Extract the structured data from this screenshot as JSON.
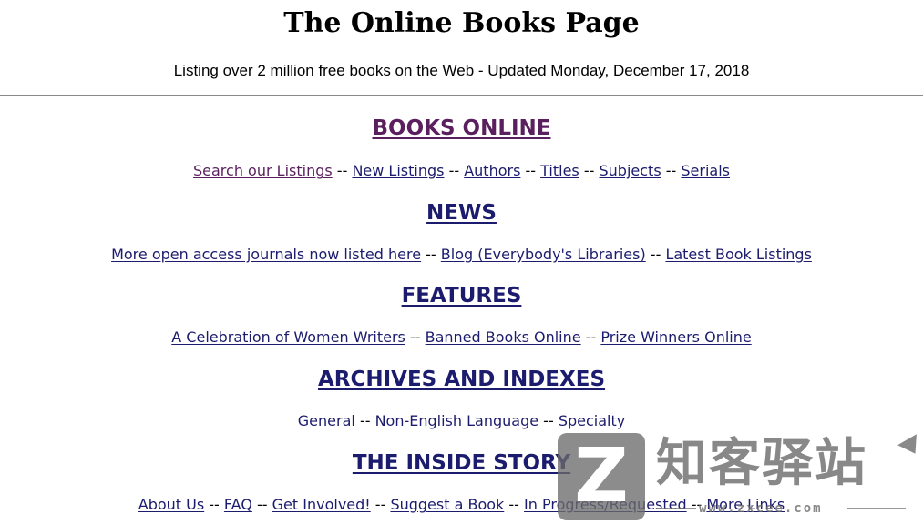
{
  "header": {
    "title": "The Online Books Page",
    "tagline": "Listing over 2 million free books on the Web - Updated Monday, December 17, 2018"
  },
  "separator": "--",
  "sections": [
    {
      "heading": "BOOKS ONLINE",
      "links": [
        "Search our Listings",
        "New Listings",
        "Authors",
        "Titles",
        "Subjects",
        "Serials"
      ]
    },
    {
      "heading": "NEWS",
      "links": [
        "More open access journals now listed here",
        "Blog (Everybody's Libraries)",
        "Latest Book Listings"
      ]
    },
    {
      "heading": "FEATURES",
      "links": [
        "A Celebration of Women Writers",
        "Banned Books Online",
        "Prize Winners Online"
      ]
    },
    {
      "heading": "ARCHIVES AND INDEXES",
      "links": [
        "General",
        "Non-English Language",
        "Specialty"
      ]
    },
    {
      "heading": "THE INSIDE STORY",
      "links": [
        "About Us",
        "FAQ",
        "Get Involved!",
        "Suggest a Book",
        "In Progress/Requested",
        "More Links"
      ]
    }
  ],
  "watermark": {
    "logo_letter": "Z",
    "brand": "知客驿站",
    "url": "www.zxcee.com"
  },
  "colors": {
    "link": "#1c1c6e",
    "visited_link": "#5a1f5e",
    "text": "#000000",
    "watermark": "#6b6b6b"
  }
}
